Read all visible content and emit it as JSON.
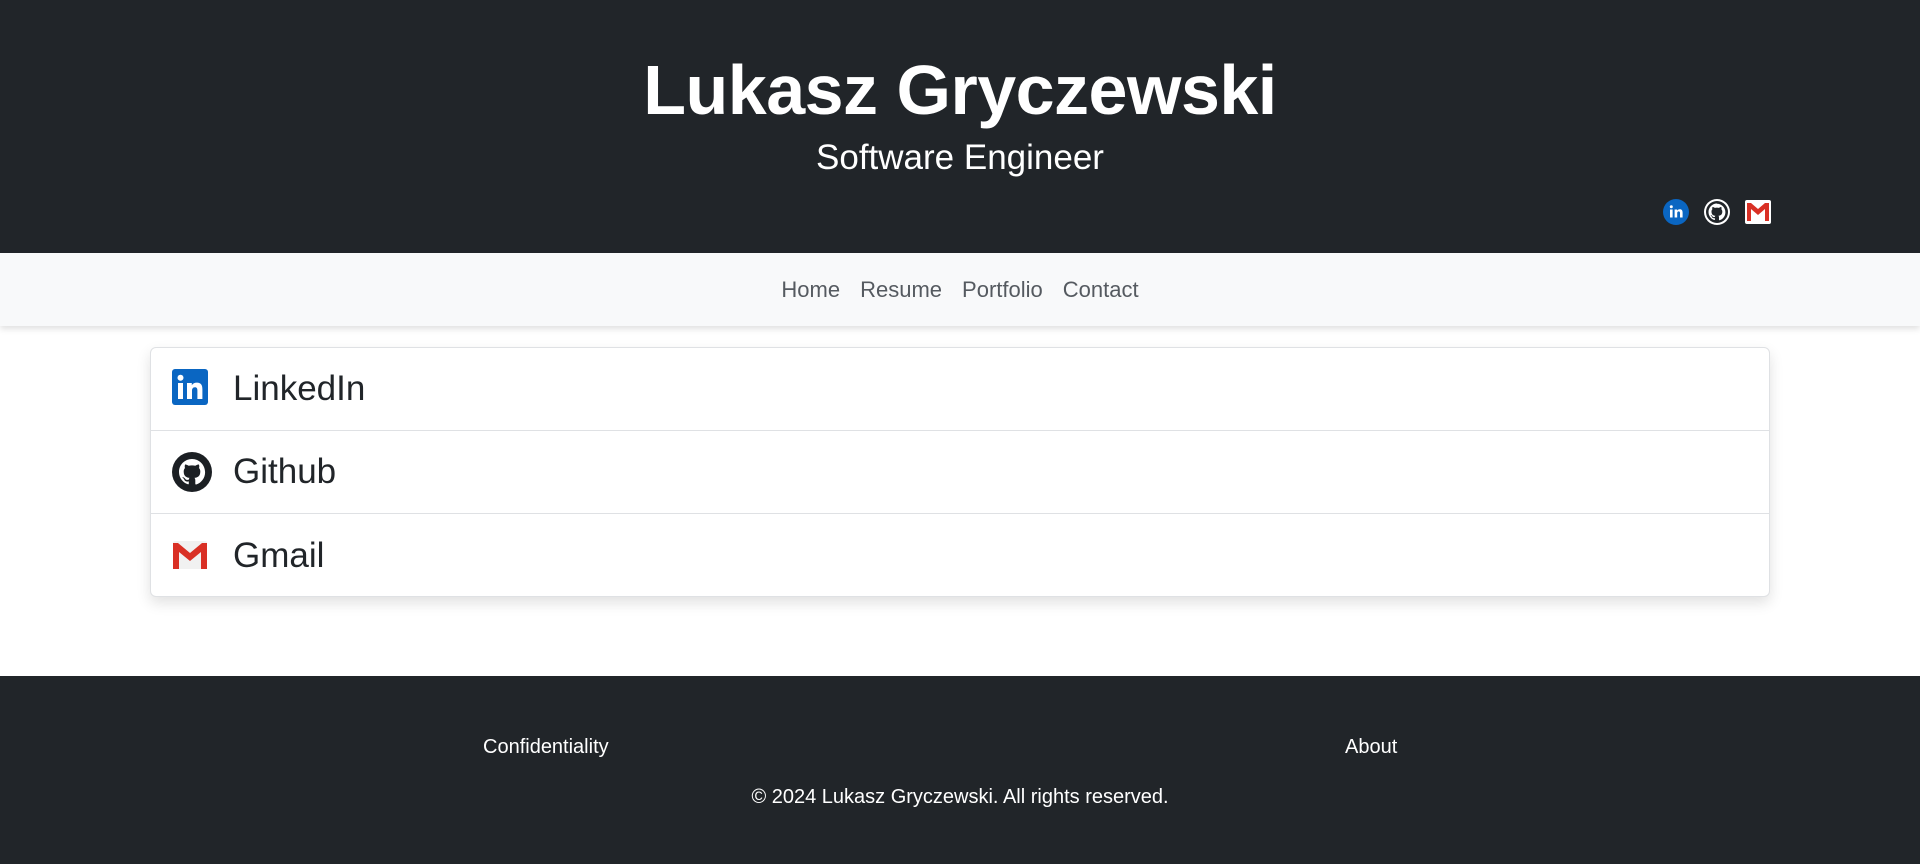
{
  "header": {
    "title": "Lukasz Gryczewski",
    "subtitle": "Software Engineer",
    "social_icons": [
      "linkedin-icon",
      "github-icon",
      "gmail-icon"
    ]
  },
  "nav": {
    "items": [
      {
        "label": "Home"
      },
      {
        "label": "Resume"
      },
      {
        "label": "Portfolio"
      },
      {
        "label": "Contact"
      }
    ]
  },
  "contact_list": {
    "items": [
      {
        "label": "LinkedIn",
        "icon": "linkedin-icon"
      },
      {
        "label": "Github",
        "icon": "github-icon"
      },
      {
        "label": "Gmail",
        "icon": "gmail-icon"
      }
    ]
  },
  "footer": {
    "left_link": "Confidentiality",
    "right_link": "About",
    "copyright": "© 2024 Lukasz Gryczewski. All rights reserved."
  },
  "colors": {
    "dark_bg": "#212529",
    "nav_bg": "#f8f9fa",
    "linkedin_blue": "#0a66c2",
    "gmail_red": "#d93025"
  }
}
